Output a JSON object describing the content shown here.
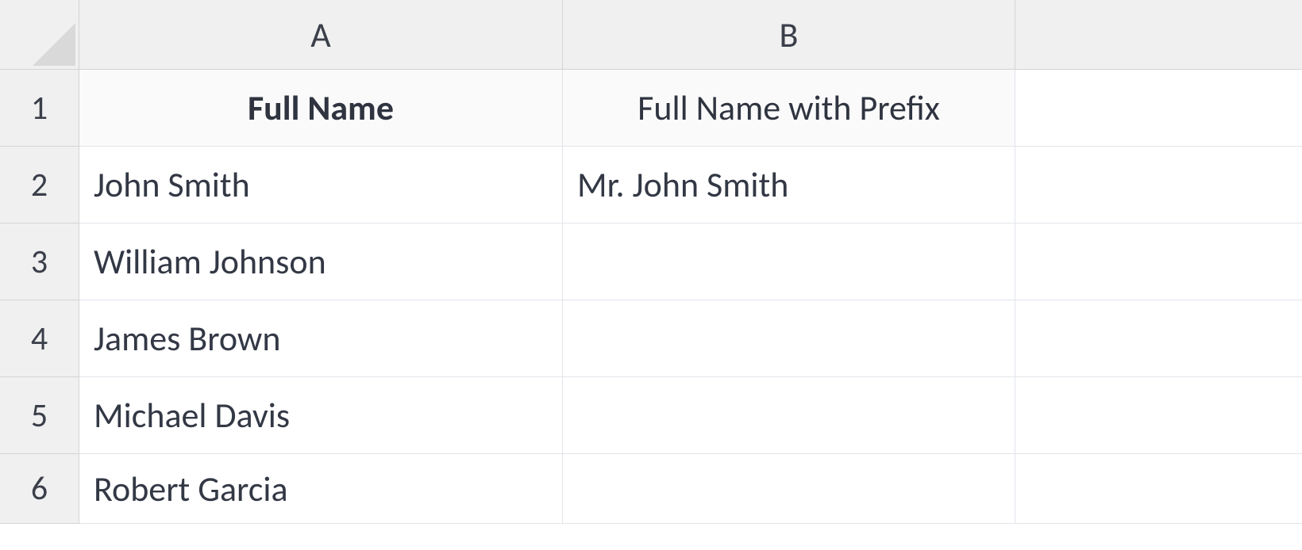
{
  "columns": [
    "A",
    "B"
  ],
  "rows": [
    "1",
    "2",
    "3",
    "4",
    "5",
    "6"
  ],
  "headers": {
    "A": "Full Name",
    "B": "Full Name with Prefix"
  },
  "data": {
    "A2": "John Smith",
    "B2": "Mr. John Smith",
    "A3": "William Johnson",
    "B3": "",
    "A4": "James Brown",
    "B4": "",
    "A5": "Michael Davis",
    "B5": "",
    "A6": "Robert Garcia",
    "B6": ""
  }
}
